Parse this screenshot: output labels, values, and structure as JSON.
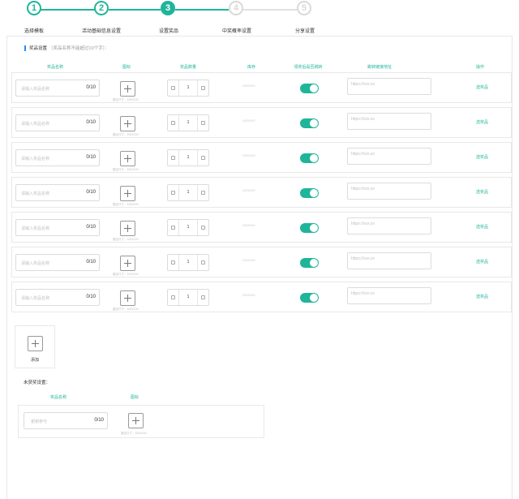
{
  "steps": [
    {
      "num": "1",
      "label": "选择模板",
      "state": "done"
    },
    {
      "num": "2",
      "label": "活动基础信息设置",
      "state": "done"
    },
    {
      "num": "3",
      "label": "设置奖品",
      "state": "active"
    },
    {
      "num": "4",
      "label": "中奖概率设置",
      "state": "todo"
    },
    {
      "num": "5",
      "label": "分享设置",
      "state": "todo"
    }
  ],
  "colors": {
    "accent": "#1fb59a",
    "inactive": "#d9d9d9",
    "section_bar": "#1890ff"
  },
  "prize_section": {
    "title": "奖品设置",
    "hint": "（奖品名称不能超过10个字）：",
    "columns": [
      "奖品名称",
      "图标",
      "奖品数量",
      "库存",
      "领奖后是否跳转",
      "跳转链接地址",
      "操作"
    ],
    "rows": [
      {
        "name_placeholder": "请输入奖品名称",
        "name_count": "0/10",
        "icon_hint": "建议尺寸：100X100",
        "quantity": "1",
        "stock": "00000000",
        "redirect_on": true,
        "url_placeholder": "https://xxx.xx",
        "action": "选奖品"
      },
      {
        "name_placeholder": "请输入奖品名称",
        "name_count": "0/10",
        "icon_hint": "建议尺寸：100X100",
        "quantity": "1",
        "stock": "00000000",
        "redirect_on": true,
        "url_placeholder": "https://xxx.xx",
        "action": "选奖品"
      },
      {
        "name_placeholder": "请输入奖品名称",
        "name_count": "0/10",
        "icon_hint": "建议尺寸：100X100",
        "quantity": "1",
        "stock": "00000000",
        "redirect_on": true,
        "url_placeholder": "https://xxx.xx",
        "action": "选奖品"
      },
      {
        "name_placeholder": "请输入奖品名称",
        "name_count": "0/10",
        "icon_hint": "建议尺寸：100X100",
        "quantity": "1",
        "stock": "00000000",
        "redirect_on": true,
        "url_placeholder": "https://xxx.xx",
        "action": "选奖品"
      },
      {
        "name_placeholder": "请输入奖品名称",
        "name_count": "0/10",
        "icon_hint": "建议尺寸：100X100",
        "quantity": "1",
        "stock": "00000000",
        "redirect_on": true,
        "url_placeholder": "https://xxx.xx",
        "action": "选奖品"
      },
      {
        "name_placeholder": "请输入奖品名称",
        "name_count": "0/10",
        "icon_hint": "建议尺寸：100X100",
        "quantity": "1",
        "stock": "00000000",
        "redirect_on": true,
        "url_placeholder": "https://xxx.xx",
        "action": "选奖品"
      },
      {
        "name_placeholder": "请输入奖品名称",
        "name_count": "0/10",
        "icon_hint": "建议尺寸：100X100",
        "quantity": "1",
        "stock": "00000000",
        "redirect_on": true,
        "url_placeholder": "https://xxx.xx",
        "action": "选奖品"
      }
    ],
    "add_label": "添加"
  },
  "no_win_section": {
    "title": "未获奖设置：",
    "columns": [
      "奖品名称",
      "图标"
    ],
    "name_placeholder": "谢谢参与",
    "name_count": "0/10",
    "icon_hint": "建议尺寸：100X100"
  }
}
